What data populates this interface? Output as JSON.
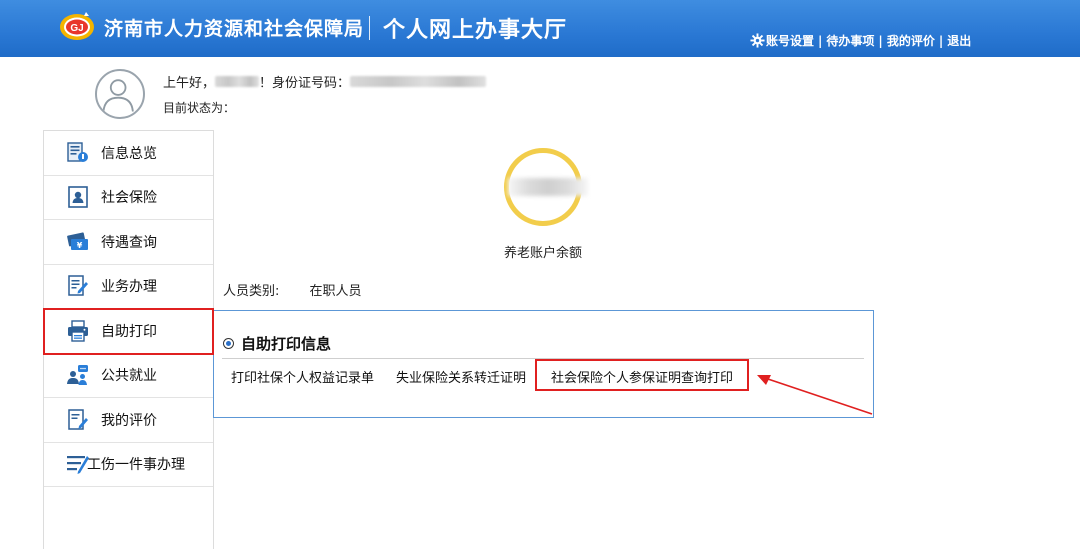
{
  "header": {
    "site_title": "济南市人力资源和社会保障局",
    "site_subtitle": "个人网上办事大厅",
    "nav": [
      {
        "label": "账号设置"
      },
      {
        "label": "待办事项"
      },
      {
        "label": "我的评价"
      },
      {
        "label": "退出"
      }
    ],
    "nav_separator": "|"
  },
  "user": {
    "greeting": "上午好，",
    "id_label": "！身份证号码：",
    "status_label": "目前状态为："
  },
  "sidebar": {
    "items": [
      {
        "label": "信息总览",
        "icon": "info-overview-icon"
      },
      {
        "label": "社会保险",
        "icon": "id-card-icon"
      },
      {
        "label": "待遇查询",
        "icon": "card-yuan-icon"
      },
      {
        "label": "业务办理",
        "icon": "document-pen-icon"
      },
      {
        "label": "自助打印",
        "icon": "printer-icon",
        "highlighted": true
      },
      {
        "label": "公共就业",
        "icon": "people-chat-icon"
      },
      {
        "label": "我的评价",
        "icon": "evaluation-icon"
      },
      {
        "label": "工伤一件事办理",
        "icon": "list-pen-icon"
      }
    ]
  },
  "main": {
    "balance_label": "养老账户余额",
    "person_type_label": "人员类别:",
    "person_type_value": "在职人员",
    "print_section": {
      "title": "自助打印信息",
      "links": [
        {
          "label": "打印社保个人权益记录单"
        },
        {
          "label": "失业保险关系转迁证明"
        },
        {
          "label": "社会保险个人参保证明查询打印",
          "highlighted": true
        }
      ]
    }
  },
  "colors": {
    "header_blue": "#2a78d4",
    "highlight_red": "#e02020",
    "ring_gold": "#f2cd4b",
    "box_border": "#5c97d6"
  }
}
